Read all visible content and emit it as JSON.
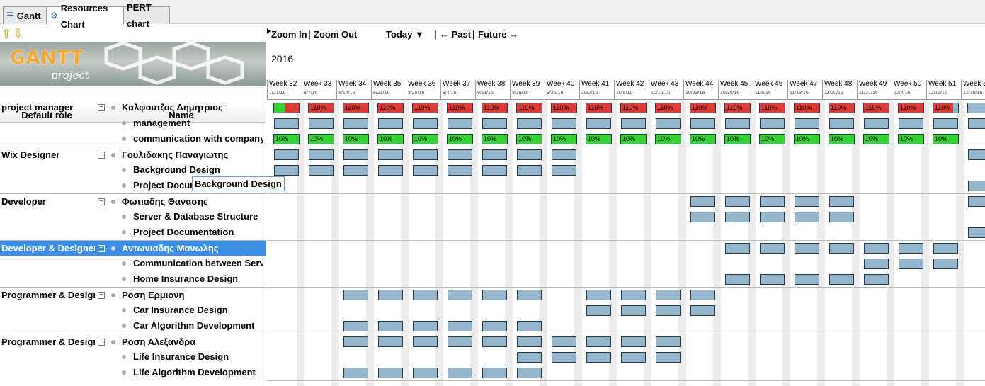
{
  "tabs": [
    {
      "label": "Gantt",
      "icon": "gantt-icon"
    },
    {
      "label": "Resources Chart",
      "icon": "resources-icon"
    },
    {
      "label": "PERT chart",
      "icon": ""
    }
  ],
  "logo": {
    "word": "GANTT",
    "sub": "project"
  },
  "columns": {
    "role": "Default role",
    "name": "Name"
  },
  "rows": [
    {
      "role": "project manager",
      "name": "Καλφουτζος Δημητριος",
      "type": "resource"
    },
    {
      "role": "",
      "name": "management",
      "type": "task"
    },
    {
      "role": "",
      "name": "communication with company",
      "type": "task"
    },
    {
      "role": "Wix Designer",
      "name": "Γουλιδακης Παναγιωτης",
      "type": "resource"
    },
    {
      "role": "",
      "name": "Background Design",
      "type": "task"
    },
    {
      "role": "",
      "name": "Project Documer",
      "type": "task"
    },
    {
      "role": "Developer",
      "name": "Φωτιαδης Θανασης",
      "type": "resource"
    },
    {
      "role": "",
      "name": "Server & Database Structure",
      "type": "task"
    },
    {
      "role": "",
      "name": "Project Documentation",
      "type": "task"
    },
    {
      "role": "Developer & Designer",
      "name": "Αντωνιαδης Μανωλης",
      "type": "resource",
      "selected": true
    },
    {
      "role": "",
      "name": "Communication between Server an...",
      "type": "task"
    },
    {
      "role": "",
      "name": "Home Insurance Design",
      "type": "task"
    },
    {
      "role": "Programmer & Designer",
      "name": "Ροση Ερμιονη",
      "type": "resource"
    },
    {
      "role": "",
      "name": "Car Insurance Design",
      "type": "task"
    },
    {
      "role": "",
      "name": "Car Algorithm Development",
      "type": "task"
    },
    {
      "role": "Programmer & Designer",
      "name": "Ροση Αλεξανδρα",
      "type": "resource"
    },
    {
      "role": "",
      "name": "Life Insurance Design",
      "type": "task"
    },
    {
      "role": "",
      "name": "Life Algorithm Development",
      "type": "task"
    }
  ],
  "tooltip": "Background Design",
  "toolbar": {
    "zoom_in": "Zoom In",
    "zoom_out": "Zoom Out",
    "today": "Today ▼",
    "past": "← Past",
    "future": "Future →"
  },
  "year": "2016",
  "weeks": [
    {
      "label": "Week 32",
      "date": "7/31/16"
    },
    {
      "label": "Week 33",
      "date": "8/7/16"
    },
    {
      "label": "Week 34",
      "date": "8/14/16"
    },
    {
      "label": "Week 35",
      "date": "8/21/16"
    },
    {
      "label": "Week 36",
      "date": "8/28/16"
    },
    {
      "label": "Week 37",
      "date": "9/4/16"
    },
    {
      "label": "Week 38",
      "date": "9/11/16"
    },
    {
      "label": "Week 39",
      "date": "9/18/16"
    },
    {
      "label": "Week 40",
      "date": "9/25/16"
    },
    {
      "label": "Week 41",
      "date": "10/2/16"
    },
    {
      "label": "Week 42",
      "date": "10/9/16"
    },
    {
      "label": "Week 43",
      "date": "10/16/16"
    },
    {
      "label": "Week 44",
      "date": "10/23/16"
    },
    {
      "label": "Week 45",
      "date": "10/30/16"
    },
    {
      "label": "Week 46",
      "date": "11/6/16"
    },
    {
      "label": "Week 47",
      "date": "11/13/16"
    },
    {
      "label": "Week 48",
      "date": "11/20/16"
    },
    {
      "label": "Week 49",
      "date": "11/27/16"
    },
    {
      "label": "Week 50",
      "date": "12/4/16"
    },
    {
      "label": "Week 51",
      "date": "12/11/16"
    },
    {
      "label": "Week 5",
      "date": "12/18/16"
    }
  ],
  "load_labels": {
    "over": "110%",
    "low": "10%"
  },
  "colors": {
    "overload": "#dd3b36",
    "underload": "#35d132",
    "task": "#93b6cc",
    "selection": "#3d8ee8"
  },
  "assignments": [
    {
      "row": 0,
      "kind": "load",
      "from": 0,
      "to": 20,
      "label": "110%"
    },
    {
      "row": 1,
      "kind": "task",
      "from": 0,
      "to": 20
    },
    {
      "row": 2,
      "kind": "load",
      "from": 0,
      "to": 19,
      "label": "10%"
    },
    {
      "row": 3,
      "kind": "task",
      "from": 0,
      "to": 8
    },
    {
      "row": 3,
      "kind": "task",
      "from": 20,
      "to": 20
    },
    {
      "row": 4,
      "kind": "task",
      "from": 0,
      "to": 8
    },
    {
      "row": 5,
      "kind": "task",
      "from": 20,
      "to": 20
    },
    {
      "row": 6,
      "kind": "task",
      "from": 12,
      "to": 16
    },
    {
      "row": 6,
      "kind": "task",
      "from": 20,
      "to": 20
    },
    {
      "row": 7,
      "kind": "task",
      "from": 12,
      "to": 16
    },
    {
      "row": 8,
      "kind": "task",
      "from": 20,
      "to": 20
    },
    {
      "row": 9,
      "kind": "task",
      "from": 13,
      "to": 19
    },
    {
      "row": 10,
      "kind": "task",
      "from": 17,
      "to": 19
    },
    {
      "row": 11,
      "kind": "task",
      "from": 13,
      "to": 17
    },
    {
      "row": 12,
      "kind": "task",
      "from": 2,
      "to": 7
    },
    {
      "row": 12,
      "kind": "task",
      "from": 9,
      "to": 12
    },
    {
      "row": 13,
      "kind": "task",
      "from": 9,
      "to": 12
    },
    {
      "row": 14,
      "kind": "task",
      "from": 2,
      "to": 7
    },
    {
      "row": 15,
      "kind": "task",
      "from": 2,
      "to": 11
    },
    {
      "row": 16,
      "kind": "task",
      "from": 7,
      "to": 11
    },
    {
      "row": 17,
      "kind": "task",
      "from": 2,
      "to": 7
    }
  ]
}
